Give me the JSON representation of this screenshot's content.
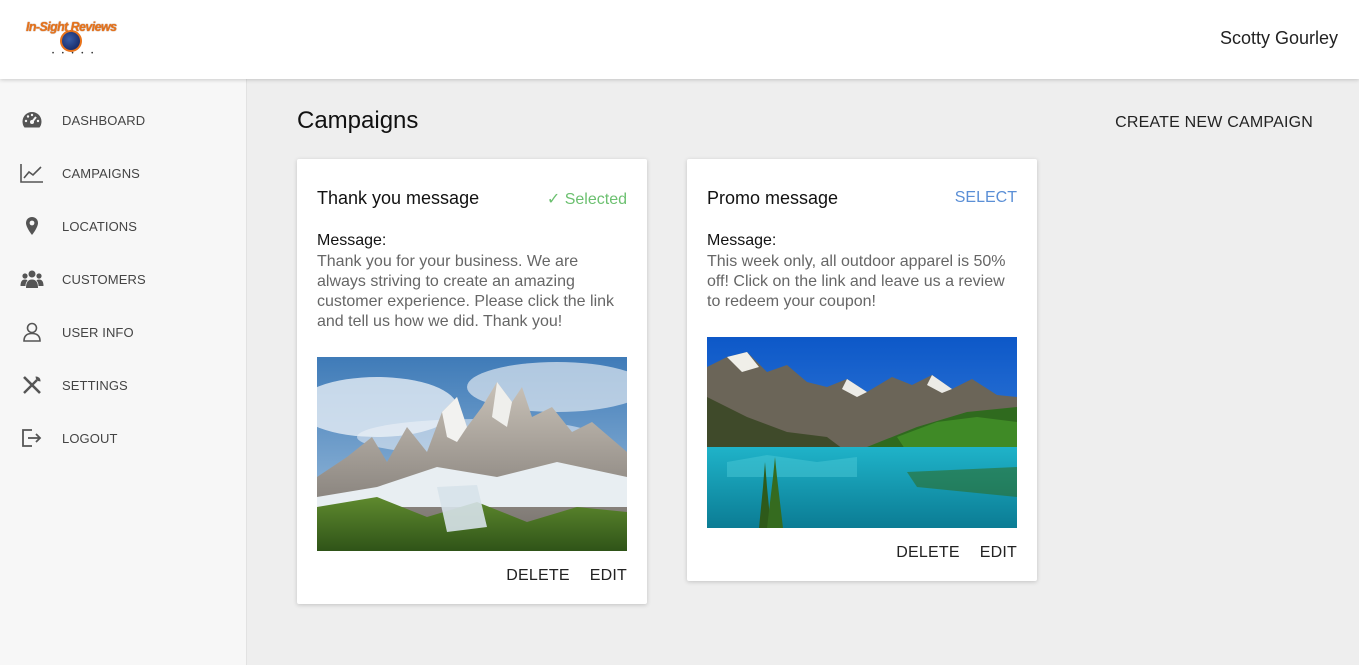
{
  "header": {
    "logo_text": "In-Sight Reviews",
    "logo_stars": "• • • • •",
    "user_name": "Scotty Gourley"
  },
  "sidebar": {
    "items": [
      {
        "label": "DASHBOARD",
        "icon": "dashboard-gauge-icon"
      },
      {
        "label": "CAMPAIGNS",
        "icon": "line-chart-icon"
      },
      {
        "label": "LOCATIONS",
        "icon": "map-pin-icon"
      },
      {
        "label": "CUSTOMERS",
        "icon": "users-icon"
      },
      {
        "label": "USER INFO",
        "icon": "user-icon"
      },
      {
        "label": "SETTINGS",
        "icon": "tools-icon"
      },
      {
        "label": "LOGOUT",
        "icon": "logout-icon"
      }
    ]
  },
  "main": {
    "title": "Campaigns",
    "create_label": "CREATE NEW CAMPAIGN"
  },
  "campaigns": [
    {
      "title": "Thank you message",
      "status": "✓ Selected",
      "message_label": "Message:",
      "message": "Thank you for your business. We are always striving to create an amazing customer experience. Please click the link and tell us how we did. Thank you!",
      "delete_label": "DELETE",
      "edit_label": "EDIT",
      "image": "snowy-mountain-peaks-photo"
    },
    {
      "title": "Promo message",
      "status": "SELECT",
      "message_label": "Message:",
      "message": "This week only, all outdoor apparel is 50% off! Click on the link and leave us a review to redeem your coupon!",
      "delete_label": "DELETE",
      "edit_label": "EDIT",
      "image": "mountain-lake-forest-photo"
    }
  ],
  "colors": {
    "selected": "#6cc070",
    "select_link": "#5b8fd6",
    "logo_orange": "#e8731a"
  }
}
